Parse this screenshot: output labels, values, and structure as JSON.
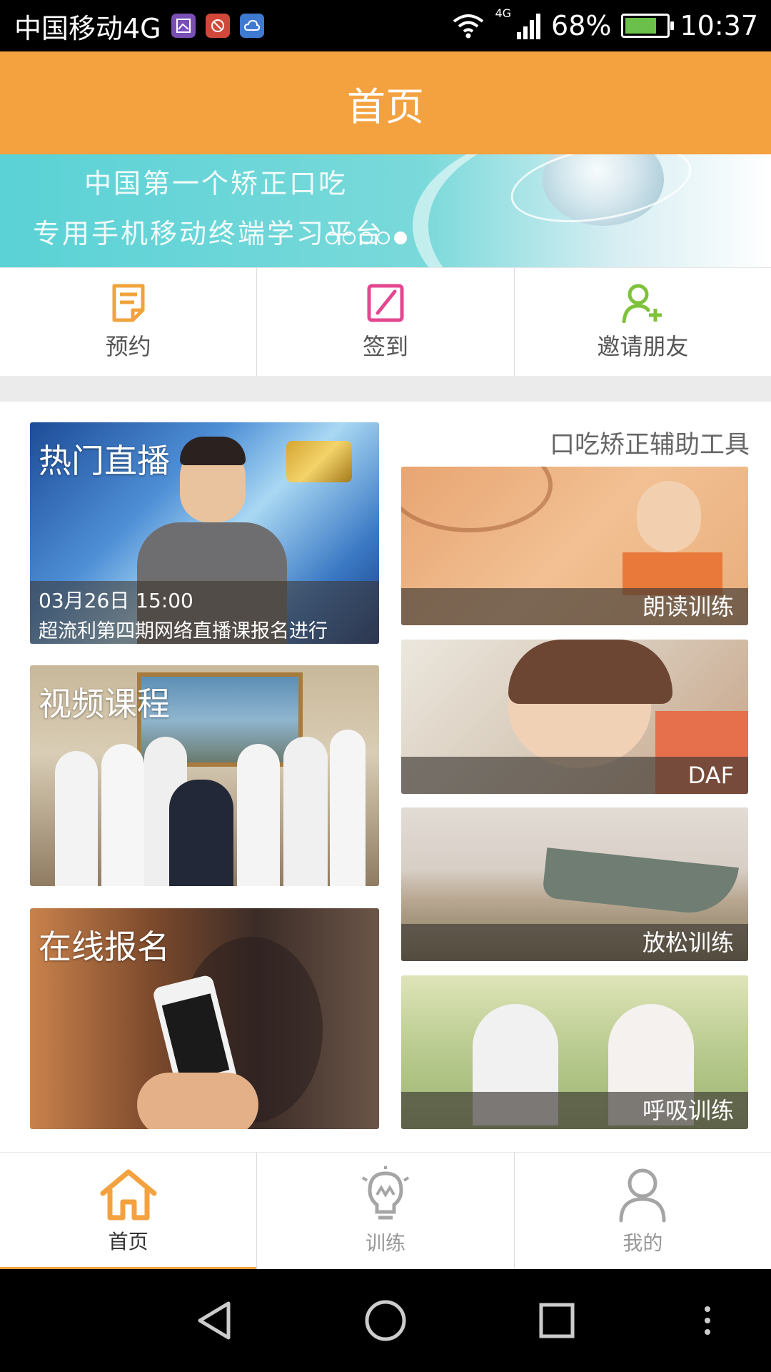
{
  "status_bar": {
    "carrier": "中国移动4G",
    "network": "4G",
    "battery": "68%",
    "time": "10:37"
  },
  "header": {
    "title": "首页"
  },
  "banner": {
    "line1": "中国第一个矫正口吃",
    "line2": "专用手机移动终端学习平台",
    "slide_count": 5,
    "active_slide": 5
  },
  "quick_actions": [
    {
      "label": "预约",
      "icon": "note-icon"
    },
    {
      "label": "签到",
      "icon": "edit-square-icon"
    },
    {
      "label": "邀请朋友",
      "icon": "add-user-icon"
    }
  ],
  "cards": {
    "live": {
      "title": "热门直播",
      "datetime": "03月26日 15:00",
      "desc": "超流利第四期网络直播课报名进行"
    },
    "video": {
      "title": "视频课程"
    },
    "signup": {
      "title": "在线报名"
    }
  },
  "tools": {
    "title": "口吃矫正辅助工具",
    "items": [
      {
        "label": "朗读训练"
      },
      {
        "label": "DAF"
      },
      {
        "label": "放松训练"
      },
      {
        "label": "呼吸训练"
      }
    ]
  },
  "bottom_nav": [
    {
      "label": "首页",
      "icon": "home-icon",
      "active": true
    },
    {
      "label": "训练",
      "icon": "lightbulb-icon",
      "active": false
    },
    {
      "label": "我的",
      "icon": "profile-icon",
      "active": false
    }
  ],
  "colors": {
    "accent": "#f4a13f",
    "quick_icon_1": "#f0a33c",
    "quick_icon_2": "#e4478f",
    "quick_icon_3": "#7ec23b"
  }
}
